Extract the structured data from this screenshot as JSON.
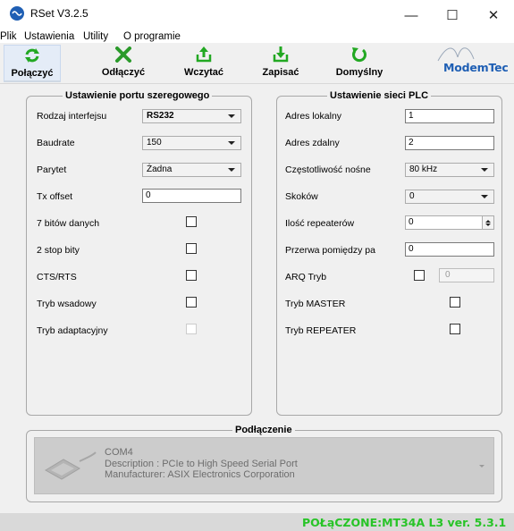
{
  "window": {
    "title": "RSet V3.2.5",
    "minimize_glyph": "—",
    "maximize_glyph": "☐",
    "close_glyph": "✕"
  },
  "menu": [
    "Plik",
    "Ustawienia",
    "Utility",
    "O programie"
  ],
  "toolbar": {
    "connect_label": "Połączyć",
    "disconnect_label": "Odłączyć",
    "load_label": "Wczytać",
    "save_label": "Zapisać",
    "default_label": "Domyślny",
    "logo_text": "ModemTec",
    "icon_color": "#22a822",
    "disconnect_color": "#2a9a2a"
  },
  "serial": {
    "title": "Ustawienie portu szeregowego",
    "interface_label": "Rodzaj interfejsu",
    "interface_value": "RS232",
    "baud_label": "Baudrate",
    "baud_value": "150",
    "parity_label": "Parytet",
    "parity_value": "Żadna",
    "tx_offset_label": "Tx offset",
    "tx_offset_value": "0",
    "data_bits_label": "7 bitów danych",
    "stop_bits_label": "2 stop bity",
    "cts_rts_label": "CTS/RTS",
    "batch_label": "Tryb wsadowy",
    "adaptive_label": "Tryb adaptacyjny"
  },
  "plc": {
    "title": "Ustawienie sieci PLC",
    "local_label": "Adres lokalny",
    "local_value": "1",
    "remote_label": "Adres zdalny",
    "remote_value": "2",
    "carrier_label": "Częstotliwość nośne",
    "carrier_value": "80 kHz",
    "hops_label": "Skoków",
    "hops_value": "0",
    "repeaters_label": "Ilość repeaterów",
    "repeaters_value": "0",
    "gap_label": "Przerwa pomiędzy pa",
    "gap_value": "0",
    "arq_label": "ARQ Tryb",
    "arq_value": "0",
    "master_label": "Tryb MASTER",
    "repeater_label": "Tryb REPEATER"
  },
  "connection": {
    "title": "Podłączenie",
    "port": "COM4",
    "description": "Description : PCIe to High Speed Serial Port",
    "manufacturer": "Manufacturer: ASIX Electronics Corporation"
  },
  "status": {
    "text": "POŁąCZONE:MT34A L3 ver. 5.3.1",
    "color": "#27c427"
  }
}
